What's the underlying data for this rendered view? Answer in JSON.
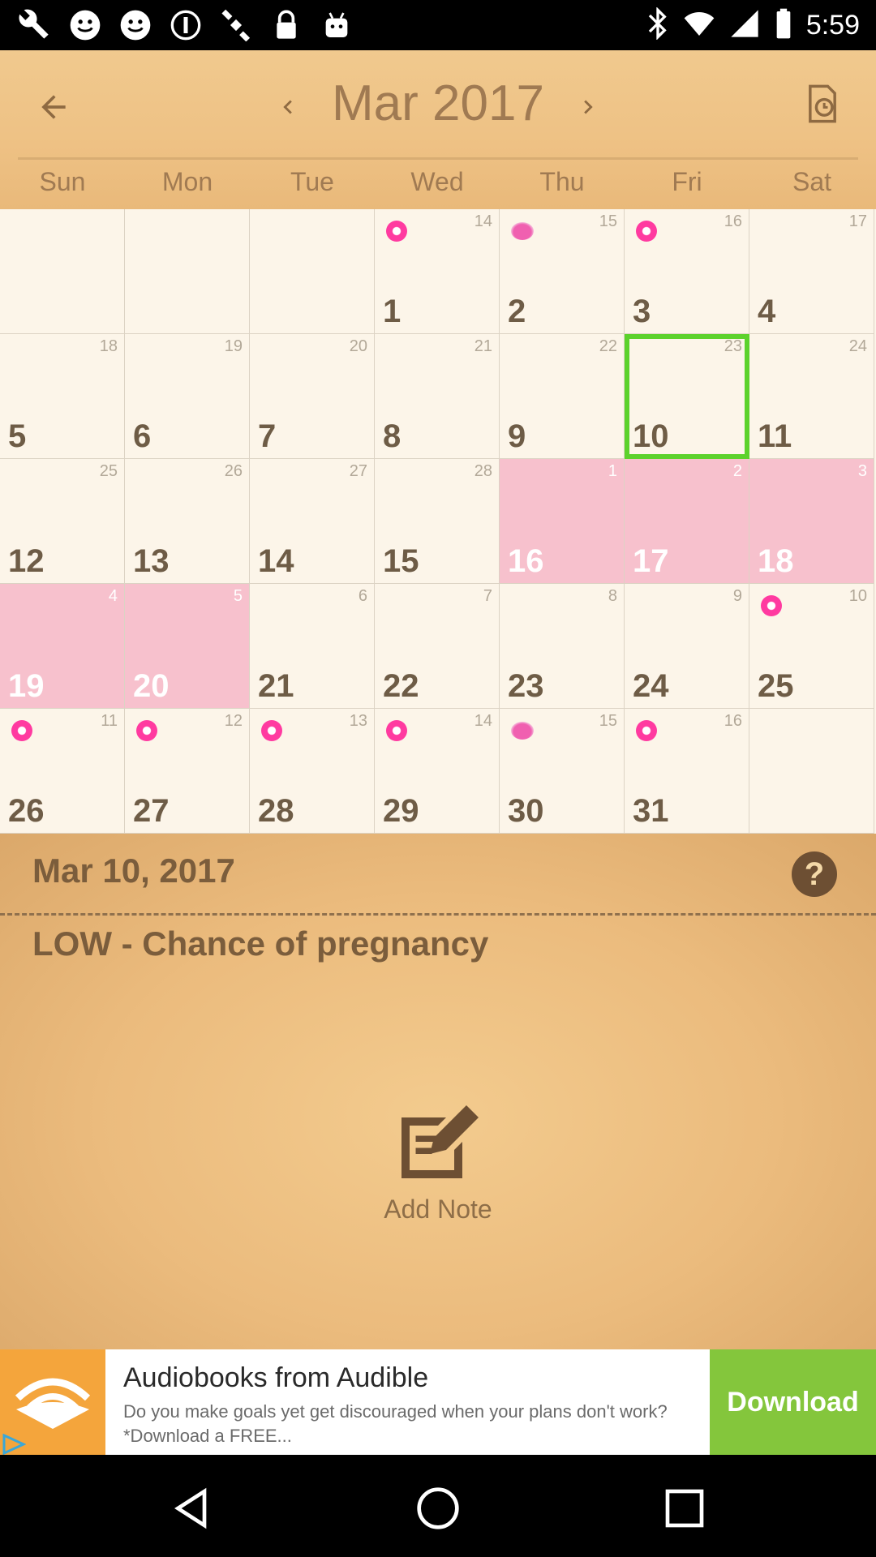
{
  "status_bar": {
    "time": "5:59",
    "icons": [
      "wrench-icon",
      "smiley-icon",
      "smiley-icon",
      "info-icon",
      "satellite-icon",
      "lock-icon",
      "android-icon"
    ]
  },
  "header": {
    "month_title": "Mar 2017",
    "weekdays": [
      "Sun",
      "Mon",
      "Tue",
      "Wed",
      "Thu",
      "Fri",
      "Sat"
    ]
  },
  "calendar": {
    "cells": [
      {
        "day": "",
        "lunar": ""
      },
      {
        "day": "",
        "lunar": ""
      },
      {
        "day": "",
        "lunar": ""
      },
      {
        "day": "1",
        "lunar": "14",
        "dot": "flower"
      },
      {
        "day": "2",
        "lunar": "15",
        "dot": "egg"
      },
      {
        "day": "3",
        "lunar": "16",
        "dot": "flower"
      },
      {
        "day": "4",
        "lunar": "17"
      },
      {
        "day": "5",
        "lunar": "18"
      },
      {
        "day": "6",
        "lunar": "19"
      },
      {
        "day": "7",
        "lunar": "20"
      },
      {
        "day": "8",
        "lunar": "21"
      },
      {
        "day": "9",
        "lunar": "22"
      },
      {
        "day": "10",
        "lunar": "23",
        "selected": true
      },
      {
        "day": "11",
        "lunar": "24"
      },
      {
        "day": "12",
        "lunar": "25"
      },
      {
        "day": "13",
        "lunar": "26"
      },
      {
        "day": "14",
        "lunar": "27"
      },
      {
        "day": "15",
        "lunar": "28"
      },
      {
        "day": "16",
        "lunar": "1",
        "pink": true
      },
      {
        "day": "17",
        "lunar": "2",
        "pink": true
      },
      {
        "day": "18",
        "lunar": "3",
        "pink": true
      },
      {
        "day": "19",
        "lunar": "4",
        "pink": true
      },
      {
        "day": "20",
        "lunar": "5",
        "pink": true
      },
      {
        "day": "21",
        "lunar": "6"
      },
      {
        "day": "22",
        "lunar": "7"
      },
      {
        "day": "23",
        "lunar": "8"
      },
      {
        "day": "24",
        "lunar": "9"
      },
      {
        "day": "25",
        "lunar": "10",
        "dot": "flower"
      },
      {
        "day": "26",
        "lunar": "11",
        "dot": "flower"
      },
      {
        "day": "27",
        "lunar": "12",
        "dot": "flower"
      },
      {
        "day": "28",
        "lunar": "13",
        "dot": "flower"
      },
      {
        "day": "29",
        "lunar": "14",
        "dot": "flower"
      },
      {
        "day": "30",
        "lunar": "15",
        "dot": "egg"
      },
      {
        "day": "31",
        "lunar": "16",
        "dot": "flower"
      },
      {
        "day": "",
        "lunar": ""
      }
    ],
    "colors": {
      "period": "#f7c1cd",
      "selected": "#5cd22c",
      "marker": "#ff3aa0"
    }
  },
  "detail": {
    "selected_date": "Mar 10, 2017",
    "help_label": "?",
    "chance_text": "LOW - Chance of pregnancy",
    "add_note_label": "Add Note"
  },
  "ad": {
    "title": "Audiobooks from Audible",
    "description": "Do you make goals yet get discouraged when your plans don't work?*Download a FREE...",
    "button_label": "Download"
  }
}
